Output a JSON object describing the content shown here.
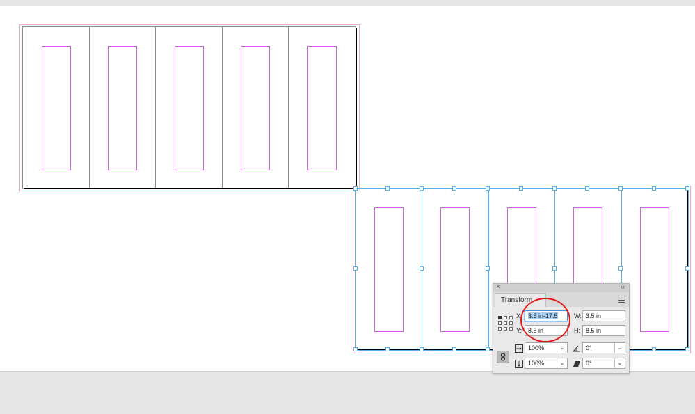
{
  "app": {
    "view": "document-pasteboard"
  },
  "spreads": [
    {
      "id": "top",
      "pages": 5
    },
    {
      "id": "bottom",
      "pages": 5,
      "selected": true
    }
  ],
  "transform_panel": {
    "title": "Transform",
    "close_glyph": "×",
    "collapse_glyph": "‹‹",
    "x_label": "X:",
    "x_value": "3.5 in-17.5",
    "y_label": "Y:",
    "y_value": "8.5 in",
    "w_label": "W:",
    "w_value": "3.5 in",
    "h_label": "H:",
    "h_value": "8.5 in",
    "scale_x": "100%",
    "scale_y": "100%",
    "rotation": "0°",
    "shear": "0°",
    "dropdown_arrow": "⌄"
  },
  "colors": {
    "margin": "#d25ee6",
    "bleed": "#f2a9c8",
    "selection": "#56b1e8",
    "annotation": "#e01b1b"
  },
  "icons": {
    "close": "close-icon",
    "collapse": "collapse-icon",
    "menu": "panel-menu-icon",
    "reference_point": "reference-point-icon",
    "constrain": "link-icon",
    "scale_x": "scale-x-icon",
    "scale_y": "scale-y-icon",
    "rotate": "rotate-icon",
    "shear": "shear-icon"
  }
}
